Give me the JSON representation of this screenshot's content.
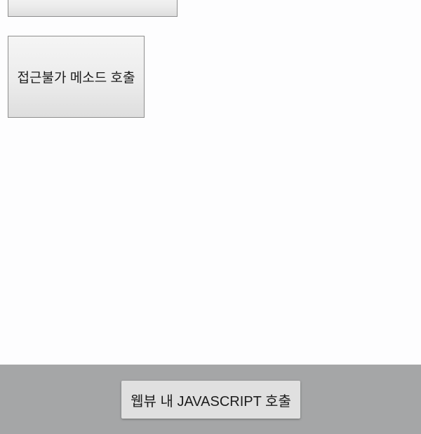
{
  "webview": {
    "top_button_label": "",
    "inaccessible_method_button_label": "접근불가 메소드 호출"
  },
  "bottom_bar": {
    "call_js_button_label": "웹뷰 내 JAVASCRIPT 호출"
  }
}
